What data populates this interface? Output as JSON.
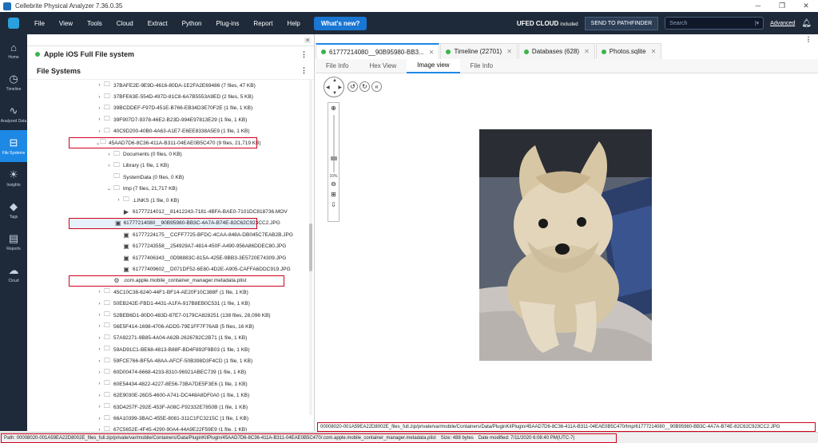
{
  "window": {
    "title": "Cellebrite Physical Analyzer 7.36.0.35",
    "minimize": "─",
    "maximize": "❐",
    "close": "✕"
  },
  "menu": {
    "items": [
      "File",
      "View",
      "Tools",
      "Cloud",
      "Extract",
      "Python",
      "Plug-ins",
      "Report",
      "Help"
    ],
    "whats_new": "What's new?",
    "ufed_cloud": "UFED CLOUD",
    "ufed_included": "included",
    "send_to_pathfinder": "SEND TO PATHFINDER",
    "search_placeholder": "Search",
    "advanced": "Advanced"
  },
  "leftnav": [
    {
      "label": "Home",
      "icon": "⌂"
    },
    {
      "label": "Timeline",
      "icon": "◷"
    },
    {
      "label": "Analyzed Data",
      "icon": "∿"
    },
    {
      "label": "File Systems",
      "icon": "⊟",
      "active": true
    },
    {
      "label": "Insights",
      "icon": "☀"
    },
    {
      "label": "Tags",
      "icon": "◆"
    },
    {
      "label": "Reports",
      "icon": "▤"
    },
    {
      "label": "Cloud",
      "icon": "☁"
    }
  ],
  "tree_panel": {
    "collapse": "«",
    "device_name": "Apple iOS Full File system",
    "section_title": "File Systems"
  },
  "tree_rows": [
    {
      "indent": 0,
      "arrow": "›",
      "icon": "folder",
      "text": "37BAFE2E-9E9D-4616-80DA-1E2FA2E69486 (7 files, 47 KB)"
    },
    {
      "indent": 0,
      "arrow": "›",
      "icon": "folder",
      "text": "37BFE63E-554D-497D-81C8-6A7B5553A9ED (2 files, 5 KB)"
    },
    {
      "indent": 0,
      "arrow": "›",
      "icon": "folder",
      "text": "39BCDDEF-F97D-451E-B766-EB34D3E70F2E (1 file, 1 KB)"
    },
    {
      "indent": 0,
      "arrow": "›",
      "icon": "folder",
      "text": "39F907D7-9378-46E2-B23D-994E97813E29 (1 file, 1 KB)"
    },
    {
      "indent": 0,
      "arrow": "›",
      "icon": "folder",
      "text": "40C9D200-40B0-4A63-A1E7-E6EE8338A5E9 (1 file, 1 KB)"
    },
    {
      "indent": 0,
      "arrow": "⌄",
      "icon": "folder",
      "text": "45AAD7D6-8C36-411A-B311-04EAE0B5C470 (9 files, 21,719 KB)",
      "highlight": true
    },
    {
      "indent": 1,
      "arrow": "›",
      "icon": "folder",
      "text": "Documents (0 files, 0 KB)"
    },
    {
      "indent": 1,
      "arrow": "›",
      "icon": "folder",
      "text": "Library (1 file, 1 KB)"
    },
    {
      "indent": 1,
      "arrow": "",
      "icon": "folder",
      "text": "SystemData (0 files, 0 KB)"
    },
    {
      "indent": 1,
      "arrow": "⌄",
      "icon": "folder",
      "text": "tmp (7 files, 21,717 KB)"
    },
    {
      "indent": 2,
      "arrow": "›",
      "icon": "folder",
      "text": ".LINKS (1 file, 0 KB)"
    },
    {
      "indent": 2,
      "arrow": "",
      "icon": "video",
      "text": "61777214012__81412243-7181-4BFA-BAE0-7101DC818736.MOV"
    },
    {
      "indent": 2,
      "arrow": "",
      "icon": "image",
      "text": "61777214080__90B95980-BB3C-4A7A-B74E-82C62C923CC2.JPG",
      "highlight": true,
      "selected": true
    },
    {
      "indent": 2,
      "arrow": "",
      "icon": "image",
      "text": "61777224175__CCFF7725-BFDC-4CAA-848A-DB045C7EAB2B.JPG"
    },
    {
      "indent": 2,
      "arrow": "",
      "icon": "image",
      "text": "61777243558__254929A7-4814-450F-A490-956A86DDEC80.JPG"
    },
    {
      "indent": 2,
      "arrow": "",
      "icon": "image",
      "text": "61777406343__0D98883C-815A-425E-9BB3-3E5720E74309.JPG"
    },
    {
      "indent": 2,
      "arrow": "",
      "icon": "image",
      "text": "61777409602__D071DF52-6E80-4D2E-A905-CAFFA6DDC919.JPG"
    },
    {
      "indent": 1,
      "arrow": "",
      "icon": "gear",
      "text": ".com.apple.mobile_container_manager.metadata.plist",
      "highlight": true
    },
    {
      "indent": 0,
      "arrow": "›",
      "icon": "folder",
      "text": "45C10C38-6240-44F1-BF14-AE20F10C388F (1 file, 1 KB)"
    },
    {
      "indent": 0,
      "arrow": "›",
      "icon": "folder",
      "text": "50EB242E-FBD1-4431-A1FA-917B8EB0C531 (1 file, 1 KB)"
    },
    {
      "indent": 0,
      "arrow": "›",
      "icon": "folder",
      "text": "52BEB6D1-80D0-483D-87E7-0179CA828251 (138 files, 28,096 KB)"
    },
    {
      "indent": 0,
      "arrow": "›",
      "icon": "folder",
      "text": "56E5F414-1698-4706-ADD5-79E1FF7F76AB (5 files, 16 KB)"
    },
    {
      "indent": 0,
      "arrow": "›",
      "icon": "folder",
      "text": "57A92271-9B85-4A04-A62B-2626782C2B71 (1 file, 1 KB)"
    },
    {
      "indent": 0,
      "arrow": "›",
      "icon": "folder",
      "text": "59AD91C1-BE68-4813-B88F-BD4F892F9B03 (1 file, 1 KB)"
    },
    {
      "indent": 0,
      "arrow": "›",
      "icon": "folder",
      "text": "59FCE766-BF5A-48AA-AFCF-50B398D3F4CD (1 file, 1 KB)"
    },
    {
      "indent": 0,
      "arrow": "›",
      "icon": "folder",
      "text": "60D00474-6668-4233-8310-96921ABEC739 (1 file, 1 KB)"
    },
    {
      "indent": 0,
      "arrow": "›",
      "icon": "folder",
      "text": "60E54434-4822-4227-8E56-73BA7DE5F3E6 (1 file, 1 KB)"
    },
    {
      "indent": 0,
      "arrow": "›",
      "icon": "folder",
      "text": "62E9030E-26D5-4600-A741-DC448A8DF0A0 (1 file, 1 KB)"
    },
    {
      "indent": 0,
      "arrow": "›",
      "icon": "folder",
      "text": "63D4257F-292E-453F-A08C-F92332E7850B (1 file, 1 KB)"
    },
    {
      "indent": 0,
      "arrow": "›",
      "icon": "folder",
      "text": "66A10399-3BAC-455E-8081-311C1FC3215C (1 file, 1 KB)"
    },
    {
      "indent": 0,
      "arrow": "›",
      "icon": "folder",
      "text": "67C5652E-4F45-4290-90A4-44A9E22F59E9 (1 file, 1 KB)"
    }
  ],
  "doc_tabs": [
    {
      "label": "61777214080__90B95980-BB3...",
      "dot": "#3ab54a",
      "active": true
    },
    {
      "label": "Timeline (22701)",
      "dot": "#3ab54a"
    },
    {
      "label": "Databases (628)",
      "dot": "#3ab54a"
    },
    {
      "label": "Photos.sqlite",
      "dot": "#3ab54a"
    }
  ],
  "sub_tabs": [
    {
      "label": "File Info"
    },
    {
      "label": "Hex View"
    },
    {
      "label": "Image view",
      "active": true
    },
    {
      "label": "File Info"
    }
  ],
  "viewer": {
    "zoom_label": "10%"
  },
  "file_path": "00008020-001A59EA22D8002E_files_full.zip/private/var/mobile/Containers/Data/PluginKitPlugin/45AAD7D6-8C36-411A-B311-04EAE0B5C470/tmp/61777214080__90B95980-BB3C-4A7A-B74E-82C62C923CC2.JPG",
  "status": {
    "path": "Path: 00008020-001A59EA22D8002E_files_full.zip/private/var/mobile/Containers/Data/PluginKitPlugin/45AAD7D6-8C36-411A-B311-04EAE0B5C470/.com.apple.mobile_container_manager.metadata.plist",
    "size": "Size: 488 bytes",
    "date_modified": "Date modified: 7/11/2020 6:08:40 PM(UTC-7)"
  }
}
